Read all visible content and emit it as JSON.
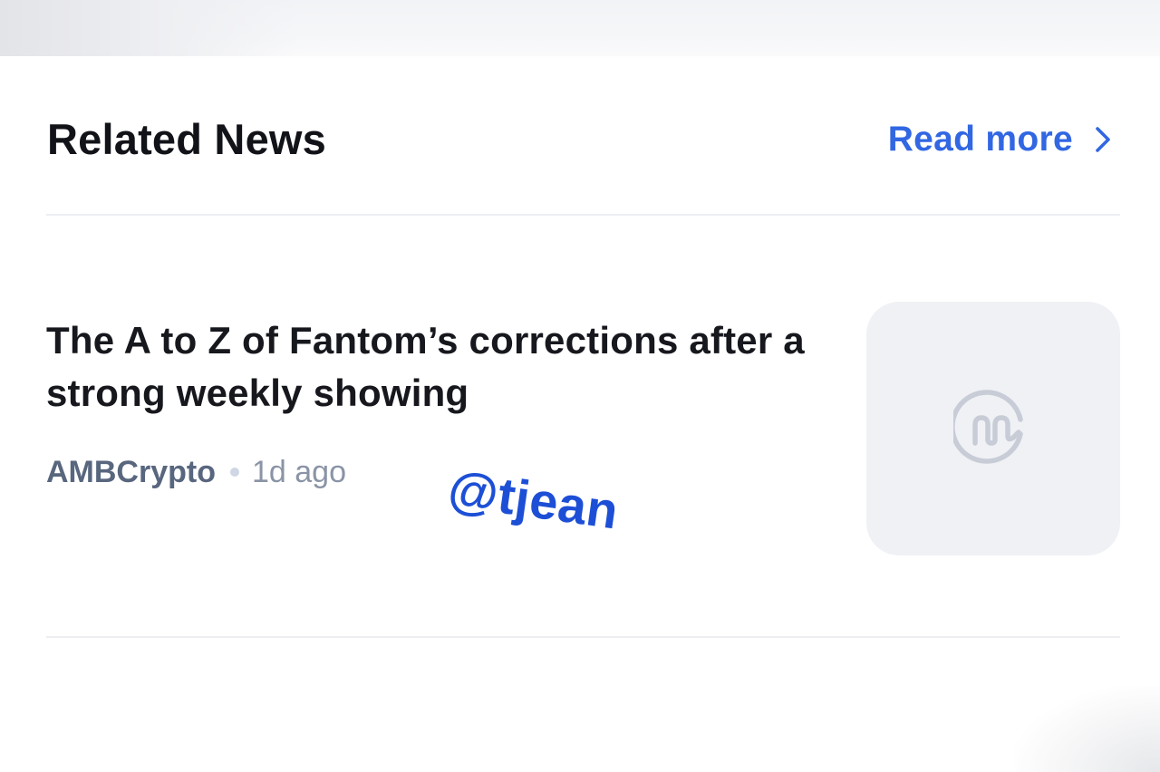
{
  "related_news": {
    "title": "Related News",
    "read_more_label": "Read more",
    "articles": [
      {
        "headline": "The A to Z of Fantom’s corrections after a strong weekly showing",
        "source": "AMBCrypto",
        "time": "1d ago",
        "thumbnail_icon": "coinmarketcap-logo-icon"
      }
    ]
  },
  "watermark": "@tjean",
  "colors": {
    "accent": "#3267e3",
    "heading": "#111318",
    "source": "#58667e",
    "time": "#8a94a6",
    "thumbnail_bg": "#eff1f5",
    "watermark": "#1d4fd6"
  }
}
